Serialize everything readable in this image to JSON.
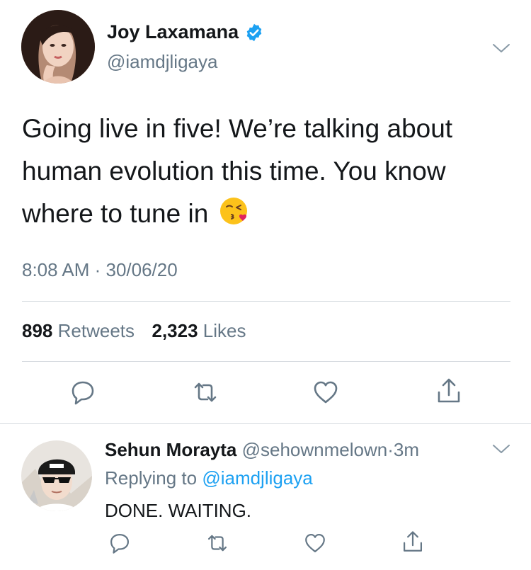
{
  "tweet": {
    "author": {
      "name": "Joy Laxamana",
      "handle": "@iamdjligaya",
      "verified": true
    },
    "text": "Going live in five! We’re talking about human evolution this time. You know where to tune in",
    "emoji": "face-blowing-a-kiss",
    "timestamp": "8:08 AM · 30/06/20",
    "stats": {
      "retweets_count": "898",
      "retweets_label": "Retweets",
      "likes_count": "2,323",
      "likes_label": "Likes"
    }
  },
  "reply": {
    "author": {
      "name": "Sehun Morayta",
      "handle": "@sehownmelown"
    },
    "separator": "·",
    "time": "3m",
    "replying_prefix": "Replying to",
    "replying_to": "@iamdjligaya",
    "text": "DONE. WAITING."
  },
  "icons": {
    "reply": "reply-icon",
    "retweet": "retweet-icon",
    "like": "heart-icon",
    "share": "share-icon",
    "menu": "chevron-down-icon",
    "verified": "verified-badge-icon"
  },
  "colors": {
    "accent": "#1da1f2",
    "verified": "#1da1f2",
    "text": "#14171a",
    "secondary": "#657786",
    "divider": "#d6dbe0"
  }
}
